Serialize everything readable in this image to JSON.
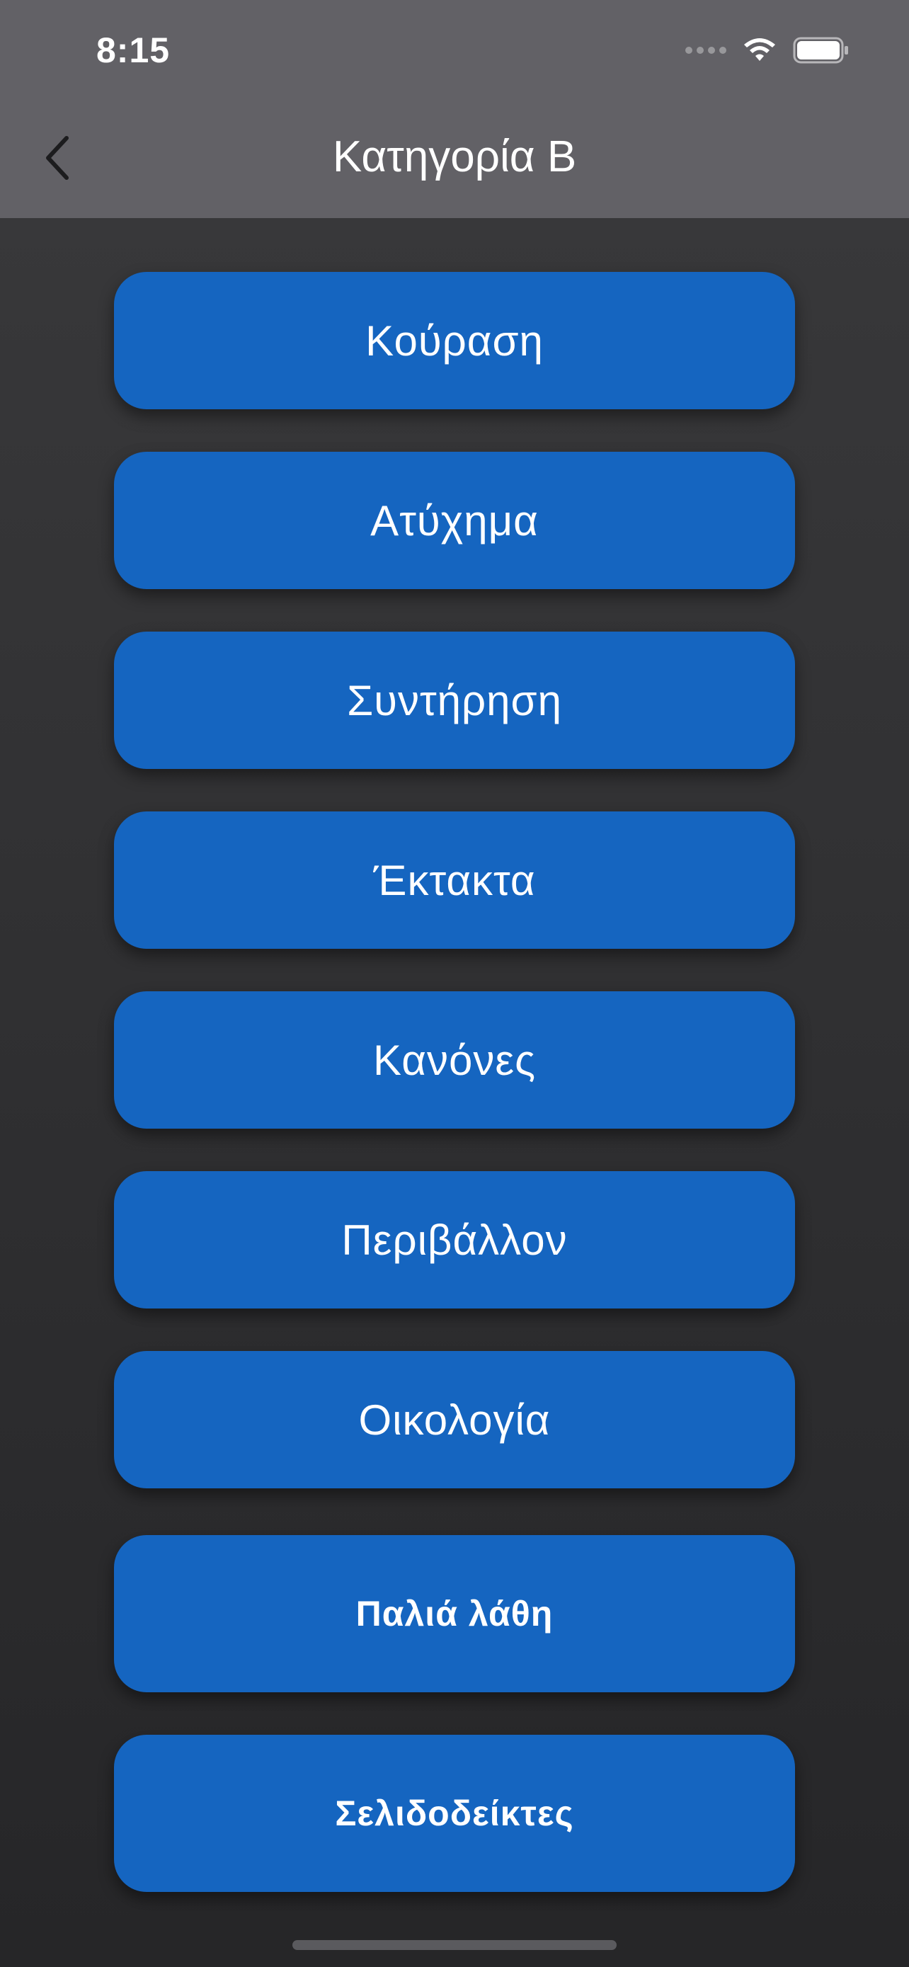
{
  "status_bar": {
    "time": "8:15",
    "icons": [
      "signal-icon",
      "wifi-icon",
      "battery-icon"
    ]
  },
  "nav": {
    "back_icon": "chevron-left-icon",
    "title": "Κατηγορία Β"
  },
  "menu": {
    "items": [
      {
        "label": "Κούραση"
      },
      {
        "label": "Ατύχημα"
      },
      {
        "label": "Συντήρηση"
      },
      {
        "label": "Έκτακτα"
      },
      {
        "label": "Κανόνες"
      },
      {
        "label": "Περιβάλλον"
      },
      {
        "label": "Οικολογία"
      },
      {
        "label": "Παλιά λάθη"
      },
      {
        "label": "Σελιδοδείκτες"
      }
    ]
  },
  "colors": {
    "topbar": "#626166",
    "button": "#1565c0",
    "background": "#2e2e30",
    "text": "#ffffff"
  }
}
